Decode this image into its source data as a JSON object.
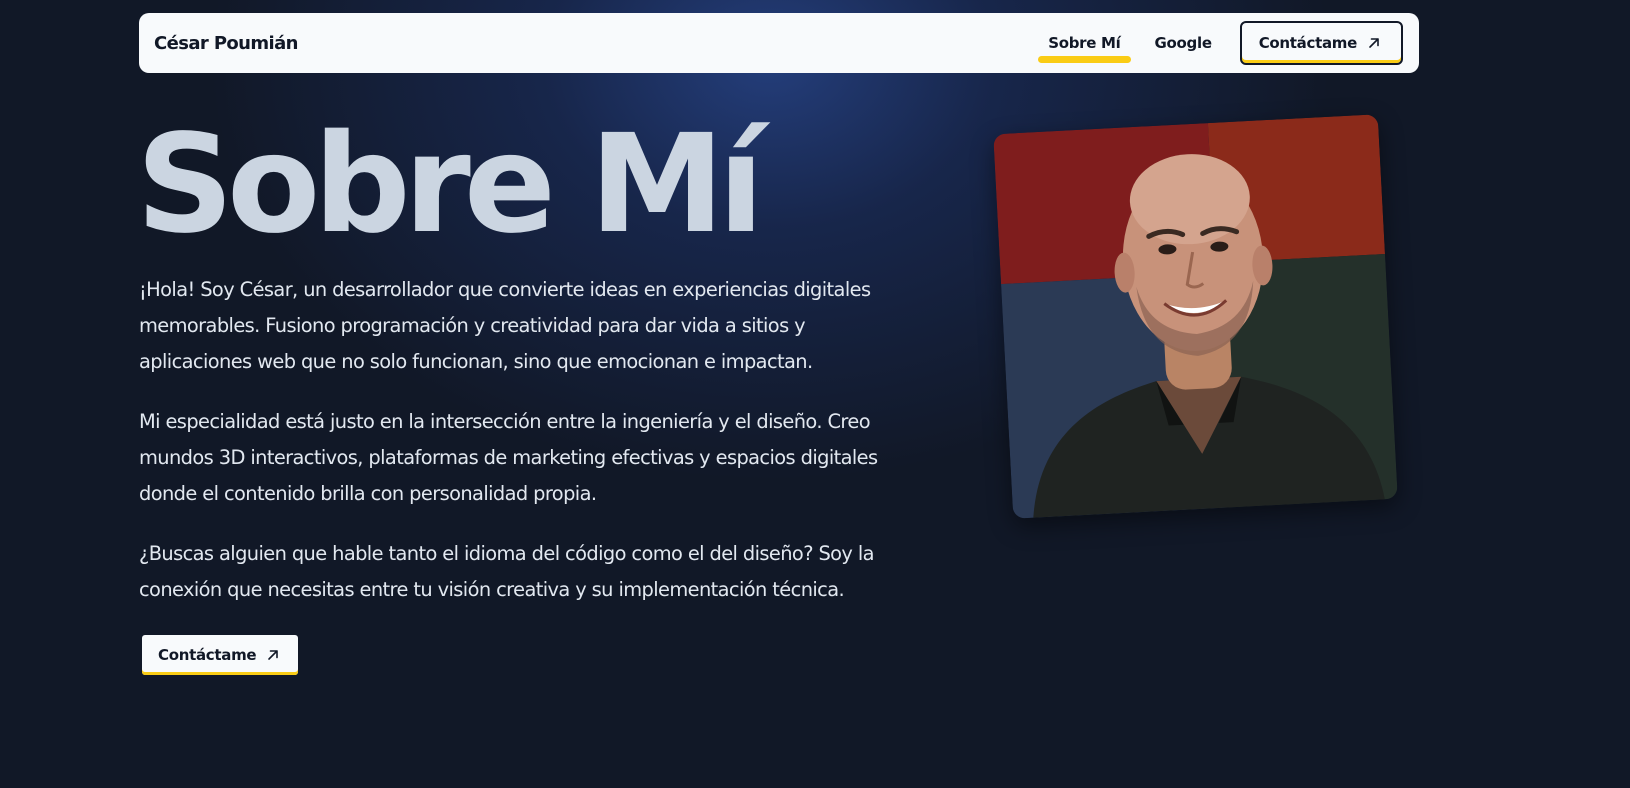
{
  "nav": {
    "brand": "César Poumián",
    "links": [
      {
        "label": "Sobre Mí",
        "active": true
      },
      {
        "label": "Google",
        "active": false
      }
    ],
    "cta_label": "Contáctame",
    "cta_icon": "arrow-up-right-icon"
  },
  "hero": {
    "title": "Sobre Mí",
    "paragraphs": [
      "¡Hola! Soy César, un desarrollador que convierte ideas en experiencias digitales memorables. Fusiono programación y creatividad para dar vida a sitios y aplicaciones web que no solo funcionan, sino que emocionan e impactan.",
      "Mi especialidad está justo en la intersección entre la ingeniería y el diseño. Creo mundos 3D interactivos, plataformas de marketing efectivas y espacios digitales donde el contenido brilla con personalidad propia.",
      "¿Buscas alguien que hable tanto el idioma del código como el del diseño? Soy la conexión que necesitas entre tu visión creativa y su implementación técnica."
    ],
    "cta_label": "Contáctame",
    "cta_icon": "arrow-up-right-icon"
  },
  "photo": {
    "icon": "portrait-photo"
  },
  "colors": {
    "background": "#111827",
    "accent": "#facc15",
    "nav_bg": "#f8fafc",
    "title": "#cbd5e1"
  }
}
